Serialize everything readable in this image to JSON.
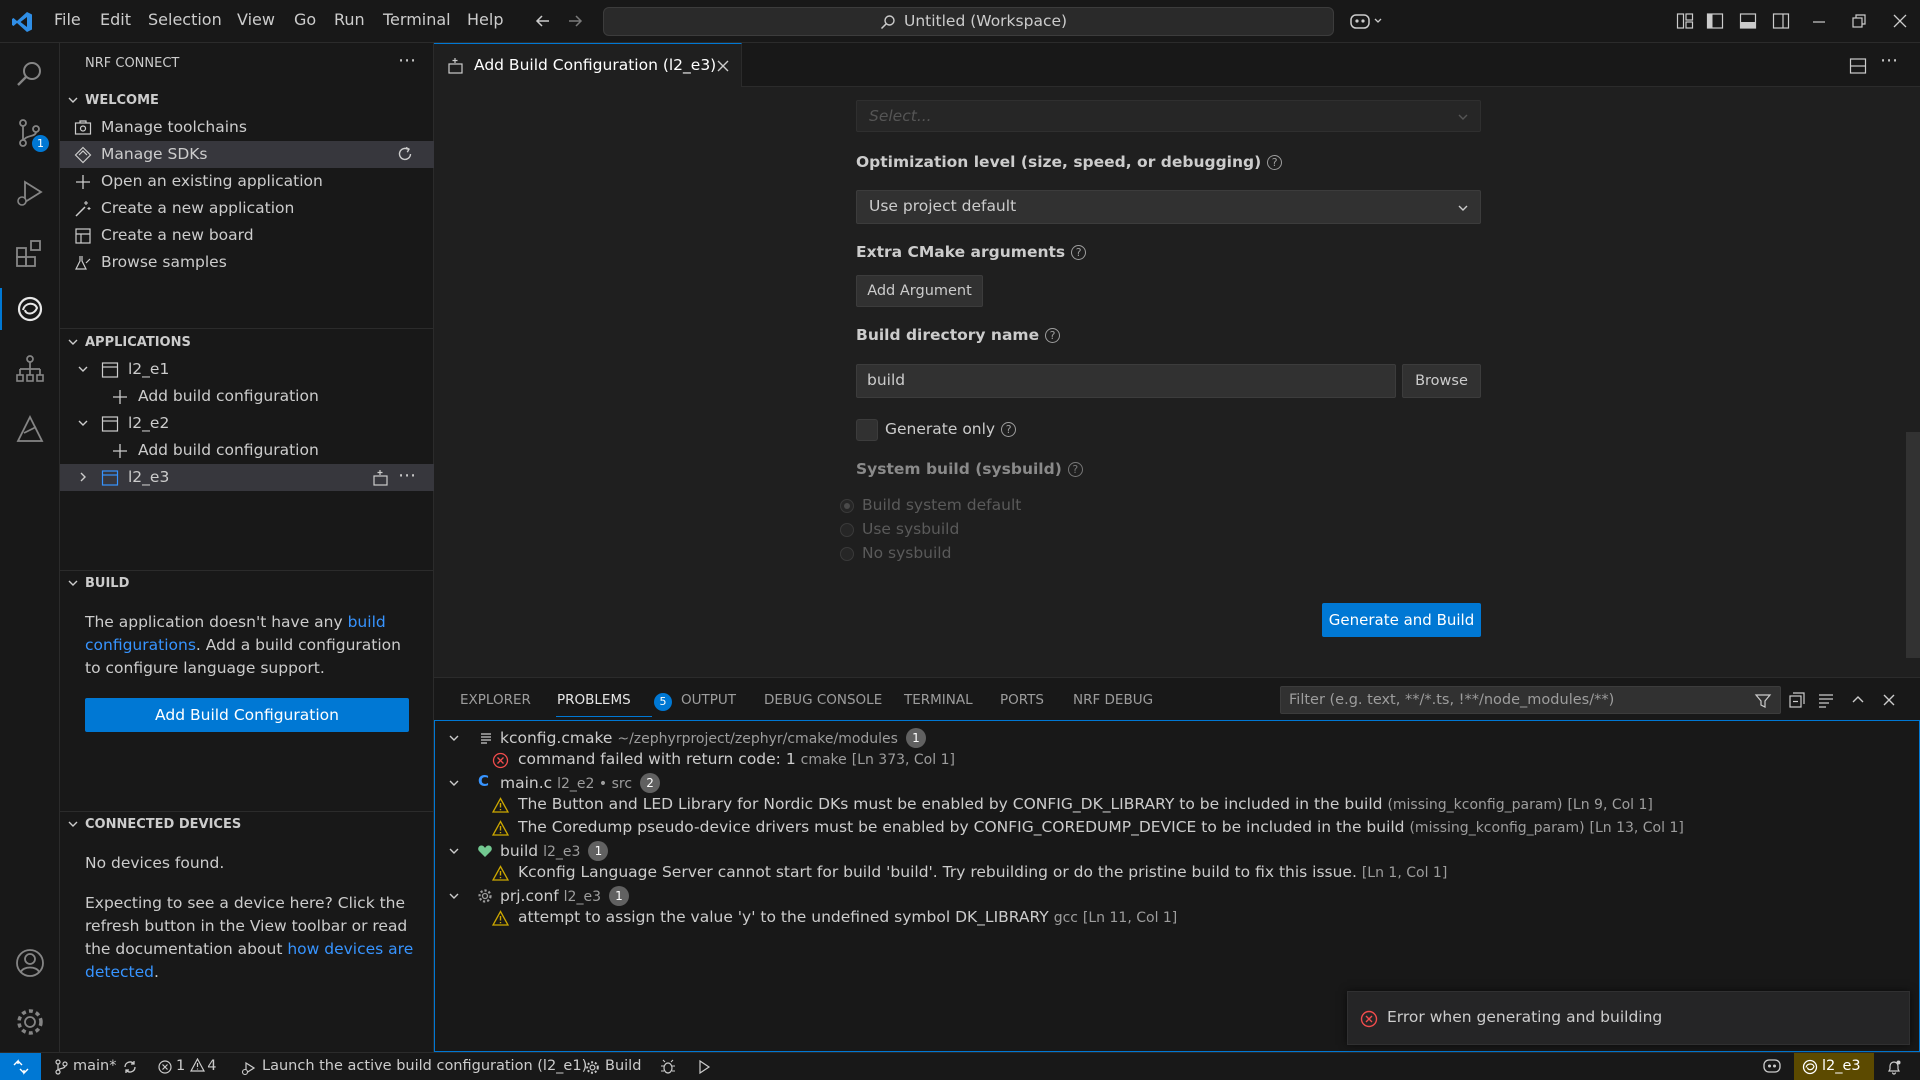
{
  "titlebar": {
    "menu": [
      "File",
      "Edit",
      "Selection",
      "View",
      "Go",
      "Run",
      "Terminal",
      "Help"
    ],
    "command_center": "Untitled (Workspace)"
  },
  "activity": {
    "source_control_badge": "1"
  },
  "sidebar": {
    "title": "NRF CONNECT",
    "welcome": {
      "heading": "WELCOME",
      "items": [
        "Manage toolchains",
        "Manage SDKs",
        "Open an existing application",
        "Create a new application",
        "Create a new board",
        "Browse samples"
      ]
    },
    "applications": {
      "heading": "APPLICATIONS",
      "apps": [
        "l2_e1",
        "l2_e2",
        "l2_e3"
      ],
      "add_build_label": "Add build configuration"
    },
    "build": {
      "heading": "BUILD",
      "text_pre": "The application doesn't have any ",
      "link1": "build",
      "link2": "configurations",
      "text_post": ". Add a build configuration to configure language support.",
      "button": "Add Build Configuration"
    },
    "devices": {
      "heading": "CONNECTED DEVICES",
      "none": "No devices found.",
      "help_pre": "Expecting to see a device here? Click the refresh button in the View toolbar or read the documentation about ",
      "help_link": "how devices are detected",
      "help_post": "."
    }
  },
  "editor": {
    "tab_title": "Add Build Configuration (l2_e3)",
    "select_placeholder": "Select...",
    "opt_label": "Optimization level (size, speed, or debugging)",
    "opt_value": "Use project default",
    "cmake_label": "Extra CMake arguments",
    "add_argument": "Add Argument",
    "builddir_label": "Build directory name",
    "builddir_value": "build",
    "browse": "Browse",
    "generate_only": "Generate only",
    "sysbuild_label": "System build (sysbuild)",
    "sysbuild_options": [
      "Build system default",
      "Use sysbuild",
      "No sysbuild"
    ],
    "generate_build": "Generate and Build"
  },
  "panel": {
    "tabs": [
      "EXPLORER",
      "PROBLEMS",
      "OUTPUT",
      "DEBUG CONSOLE",
      "TERMINAL",
      "PORTS",
      "NRF DEBUG"
    ],
    "problems_count": "5",
    "filter_placeholder": "Filter (e.g. text, **/*.ts, !**/node_modules/**)",
    "groups": [
      {
        "file": "kconfig.cmake",
        "path": "~/zephyrproject/zephyr/cmake/modules",
        "count": "1",
        "items": [
          {
            "msg": "command failed with return code: 1",
            "src": "cmake",
            "loc": "[Ln 373, Col 1]"
          }
        ]
      },
      {
        "file": "main.c",
        "path": "l2_e2 • src",
        "count": "2",
        "items": [
          {
            "msg": "The Button and LED Library for Nordic DKs must be enabled by CONFIG_DK_LIBRARY to be included in the build",
            "src": "(missing_kconfig_param)",
            "loc": "[Ln 9, Col 1]"
          },
          {
            "msg": "The Coredump pseudo-device drivers must be enabled by CONFIG_COREDUMP_DEVICE to be included in the build",
            "src": "(missing_kconfig_param)",
            "loc": "[Ln 13, Col 1]"
          }
        ]
      },
      {
        "file": "build",
        "path": "l2_e3",
        "count": "1",
        "items": [
          {
            "msg": "Kconfig Language Server cannot start for build 'build'. Try rebuilding or do the pristine build to fix this issue.",
            "src": "",
            "loc": "[Ln 1, Col 1]"
          }
        ]
      },
      {
        "file": "prj.conf",
        "path": "l2_e3",
        "count": "1",
        "items": [
          {
            "msg": "attempt to assign the value 'y' to the undefined symbol DK_LIBRARY",
            "src": "gcc",
            "loc": "[Ln 11, Col 1]"
          }
        ]
      }
    ]
  },
  "toast": {
    "message": "Error when generating and building"
  },
  "statusbar": {
    "branch": "main*",
    "errors": "1",
    "warnings": "4",
    "launch": "Launch the active build configuration (l2_e1)",
    "build": "Build",
    "active_app": "l2_e3"
  }
}
